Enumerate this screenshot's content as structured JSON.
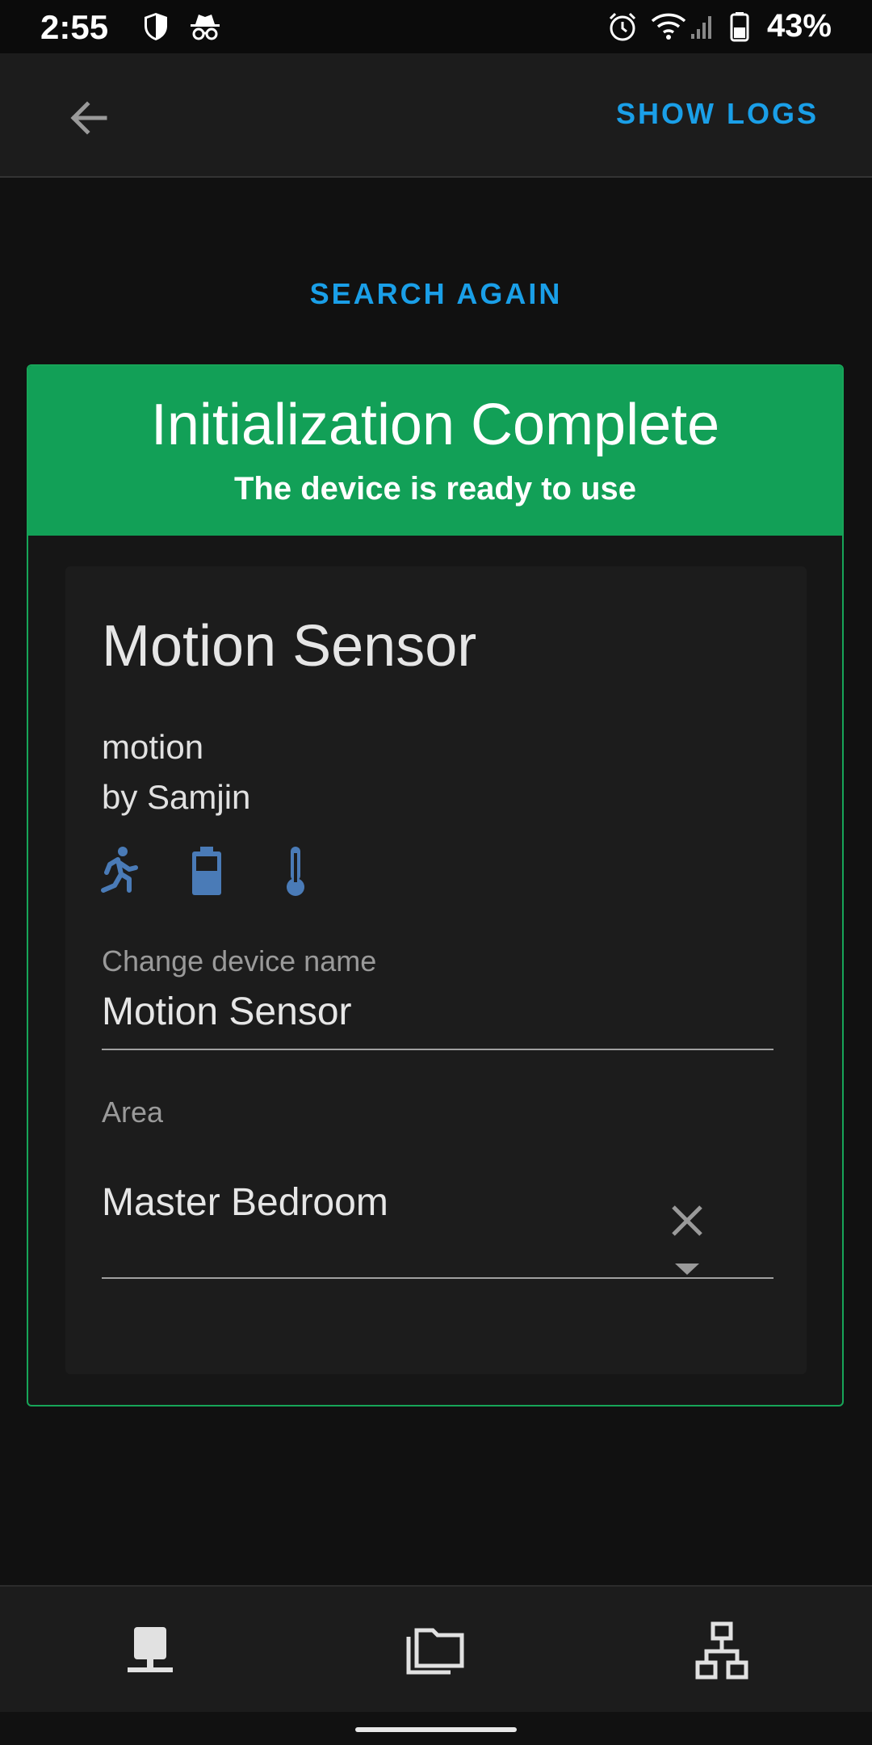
{
  "status_bar": {
    "time": "2:55",
    "battery": "43%",
    "icons": [
      "shield-icon",
      "incognito-icon",
      "alarm-icon",
      "wifi-icon",
      "signal-icon",
      "battery-icon"
    ]
  },
  "app_bar": {
    "back_icon": "arrow-left-icon",
    "show_logs_label": "SHOW LOGS"
  },
  "search_again_label": "SEARCH AGAIN",
  "result": {
    "title": "Initialization Complete",
    "subtitle": "The device is ready to use",
    "accent_color": "#12a057"
  },
  "device": {
    "name": "Motion Sensor",
    "model": "motion",
    "manufacturer": "by Samjin",
    "capability_icons": [
      "motion-run-icon",
      "battery-icon",
      "thermometer-icon"
    ],
    "capability_color": "#4a7bb7"
  },
  "form": {
    "name_label": "Change device name",
    "name_value": "Motion Sensor",
    "area_label": "Area",
    "area_value": "Master Bedroom"
  },
  "bottom_nav": {
    "items": [
      "devices-icon",
      "folders-icon",
      "network-icon"
    ]
  },
  "colors": {
    "link": "#1a9fe8",
    "background": "#111111",
    "surface": "#1c1c1c"
  }
}
